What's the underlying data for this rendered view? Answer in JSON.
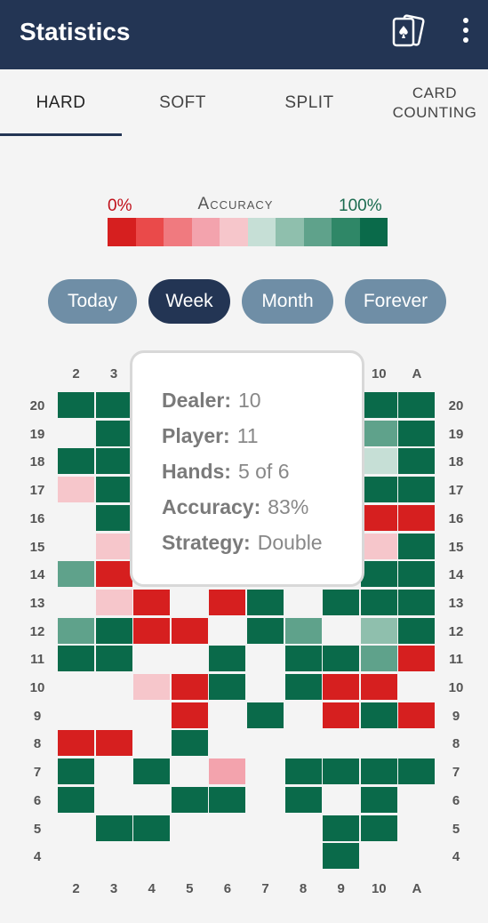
{
  "app_bar": {
    "title": "Statistics",
    "cards_icon": "playing-cards-icon",
    "menu_icon": "more-vert-icon"
  },
  "tabs": [
    {
      "label": "HARD",
      "active": true
    },
    {
      "label": "SOFT",
      "active": false
    },
    {
      "label": "SPLIT",
      "active": false
    },
    {
      "label": "CARD COUNTING",
      "active": false
    }
  ],
  "legend": {
    "min": "0%",
    "label": "Accuracy",
    "max": "100%",
    "colors": [
      "#d61f1f",
      "#ea4a4a",
      "#f07a7f",
      "#f3a3ad",
      "#f6c6cb",
      "#c6dfd6",
      "#8fbfad",
      "#5fa28b",
      "#2f8767",
      "#0a6a4a"
    ]
  },
  "periods": [
    {
      "label": "Today",
      "active": false
    },
    {
      "label": "Week",
      "active": true
    },
    {
      "label": "Month",
      "active": false
    },
    {
      "label": "Forever",
      "active": false
    }
  ],
  "grid": {
    "dealer_cols": [
      "2",
      "3",
      "4",
      "5",
      "6",
      "7",
      "8",
      "9",
      "10",
      "A"
    ],
    "player_rows": [
      "20",
      "19",
      "18",
      "17",
      "16",
      "15",
      "14",
      "13",
      "12",
      "11",
      "10",
      "9",
      "8",
      "7",
      "6",
      "5",
      "4"
    ],
    "cells": [
      [
        "#0a6a4a",
        "#0a6a4a",
        "#0a6a4a",
        "#0a6a4a",
        "#0a6a4a",
        "#0a6a4a",
        "#0a6a4a",
        "#0a6a4a",
        "#0a6a4a",
        "#0a6a4a"
      ],
      [
        "",
        "#0a6a4a",
        "",
        "",
        "",
        "",
        "",
        "#0a6a4a",
        "#5fa28b",
        "#0a6a4a"
      ],
      [
        "#0a6a4a",
        "#0a6a4a",
        "",
        "",
        "",
        "",
        "",
        "",
        "#c6dfd6",
        "#0a6a4a"
      ],
      [
        "#f6c6cb",
        "#0a6a4a",
        "",
        "",
        "",
        "",
        "",
        "",
        "#0a6a4a",
        "#0a6a4a"
      ],
      [
        "",
        "#0a6a4a",
        "",
        "",
        "",
        "",
        "",
        "",
        "#d61f1f",
        "#d61f1f"
      ],
      [
        "",
        "#f6c6cb",
        "",
        "",
        "",
        "",
        "",
        "",
        "#f6c6cb",
        "#0a6a4a"
      ],
      [
        "#5fa28b",
        "#d61f1f",
        "",
        "",
        "",
        "",
        "",
        "",
        "#0a6a4a",
        "#0a6a4a"
      ],
      [
        "",
        "#f6c6cb",
        "#d61f1f",
        "",
        "#d61f1f",
        "#0a6a4a",
        "",
        "#0a6a4a",
        "#0a6a4a",
        "#0a6a4a"
      ],
      [
        "#5fa28b",
        "#0a6a4a",
        "#d61f1f",
        "#d61f1f",
        "",
        "#0a6a4a",
        "#5fa28b",
        "",
        "#8fbfad",
        "#0a6a4a"
      ],
      [
        "#0a6a4a",
        "#0a6a4a",
        "",
        "",
        "#0a6a4a",
        "",
        "#0a6a4a",
        "#0a6a4a",
        "#5fa28b",
        "#d61f1f"
      ],
      [
        "",
        "",
        "#f6c6cb",
        "#d61f1f",
        "#0a6a4a",
        "",
        "#0a6a4a",
        "#d61f1f",
        "#d61f1f",
        ""
      ],
      [
        "",
        "",
        "",
        "#d61f1f",
        "",
        "#0a6a4a",
        "",
        "#d61f1f",
        "#0a6a4a",
        "#d61f1f"
      ],
      [
        "#d61f1f",
        "#d61f1f",
        "",
        "#0a6a4a",
        "",
        "",
        "",
        "",
        "",
        ""
      ],
      [
        "#0a6a4a",
        "",
        "#0a6a4a",
        "",
        "#f3a3ad",
        "",
        "#0a6a4a",
        "#0a6a4a",
        "#0a6a4a",
        "#0a6a4a"
      ],
      [
        "#0a6a4a",
        "",
        "",
        "#0a6a4a",
        "#0a6a4a",
        "",
        "#0a6a4a",
        "",
        "#0a6a4a",
        ""
      ],
      [
        "",
        "#0a6a4a",
        "#0a6a4a",
        "",
        "",
        "",
        "",
        "#0a6a4a",
        "#0a6a4a",
        ""
      ],
      [
        "",
        "",
        "",
        "",
        "",
        "",
        "",
        "#0a6a4a",
        "",
        ""
      ]
    ]
  },
  "tooltip": {
    "dealer_label": "Dealer:",
    "dealer_value": "10",
    "player_label": "Player:",
    "player_value": "11",
    "hands_label": "Hands:",
    "hands_value": "5 of 6",
    "accuracy_label": "Accuracy:",
    "accuracy_value": "83%",
    "strategy_label": "Strategy:",
    "strategy_value": "Double"
  }
}
